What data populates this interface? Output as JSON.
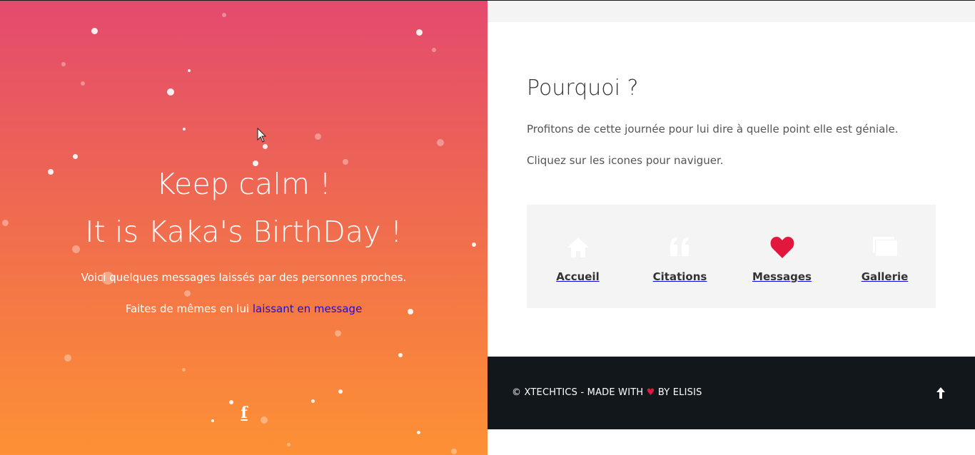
{
  "hero": {
    "title_line1": "Keep calm !",
    "title_line2": "It is Kaka's BirthDay !",
    "text1": "Voici quelques messages laissés par des personnes proches.",
    "text2_prefix": "Faites de mêmes en lui ",
    "text2_link": "laissant en message",
    "facebook_glyph": "f",
    "gradient_top": "#e44a6e",
    "gradient_bottom": "#fd9135",
    "link_color": "#1a0dde"
  },
  "section": {
    "title": "Pourquoi ?",
    "text1": "Profitons de cette journée pour lui dire à quelle point elle est géniale.",
    "text2": "Cliquez sur les icones pour naviguer."
  },
  "nav": {
    "items": [
      {
        "label": "Accueil",
        "icon": "home-icon"
      },
      {
        "label": "Citations",
        "icon": "quote-icon"
      },
      {
        "label": "Messages",
        "icon": "heart-icon",
        "active_color": "#e3163d"
      },
      {
        "label": "Gallerie",
        "icon": "gallery-icon"
      }
    ]
  },
  "footer": {
    "prefix": "© XTECHTICS - MADE WITH ",
    "heart": "♥",
    "suffix": " BY ELISIS",
    "background": "#12171c"
  }
}
